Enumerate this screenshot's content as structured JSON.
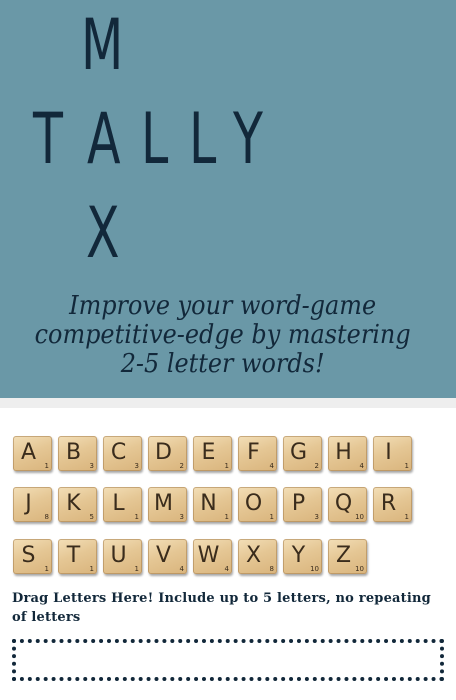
{
  "logo": {
    "across": [
      "T",
      "A",
      "L",
      "L",
      "Y"
    ],
    "down_top": "M",
    "down_bottom": "X"
  },
  "tagline": [
    "Improve your word-game",
    "competitive-edge by mastering",
    "2-5 letter words!"
  ],
  "tiles": [
    {
      "letter": "A",
      "points": "1"
    },
    {
      "letter": "B",
      "points": "3"
    },
    {
      "letter": "C",
      "points": "3"
    },
    {
      "letter": "D",
      "points": "2"
    },
    {
      "letter": "E",
      "points": "1"
    },
    {
      "letter": "F",
      "points": "4"
    },
    {
      "letter": "G",
      "points": "2"
    },
    {
      "letter": "H",
      "points": "4"
    },
    {
      "letter": "I",
      "points": "1"
    },
    {
      "letter": "J",
      "points": "8"
    },
    {
      "letter": "K",
      "points": "5"
    },
    {
      "letter": "L",
      "points": "1"
    },
    {
      "letter": "M",
      "points": "3"
    },
    {
      "letter": "N",
      "points": "1"
    },
    {
      "letter": "O",
      "points": "1"
    },
    {
      "letter": "P",
      "points": "3"
    },
    {
      "letter": "Q",
      "points": "10"
    },
    {
      "letter": "R",
      "points": "1"
    },
    {
      "letter": "S",
      "points": "1"
    },
    {
      "letter": "T",
      "points": "1"
    },
    {
      "letter": "U",
      "points": "1"
    },
    {
      "letter": "V",
      "points": "4"
    },
    {
      "letter": "W",
      "points": "4"
    },
    {
      "letter": "X",
      "points": "8"
    },
    {
      "letter": "Y",
      "points": "10"
    },
    {
      "letter": "Z",
      "points": "10"
    }
  ],
  "instructions": "Drag Letters Here! Include up to 5 letters, no repeating of letters",
  "colors": {
    "hero_bg": "#6a98a7",
    "ink": "#12283a",
    "tile_wood": "#e5c795"
  }
}
